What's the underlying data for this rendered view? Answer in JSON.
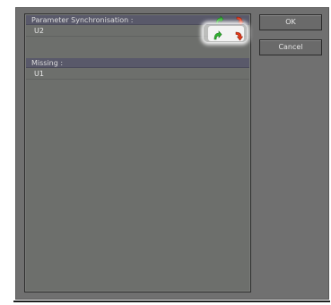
{
  "sync_section": {
    "header": "Parameter Synchronisation :",
    "items": [
      {
        "label": "U2"
      }
    ]
  },
  "missing_section": {
    "header": "Missing :",
    "items": [
      {
        "label": "U1"
      }
    ]
  },
  "buttons": {
    "ok": "OK",
    "cancel": "Cancel"
  },
  "icons": {
    "sync_all": "green-curved-arrow-icon",
    "unsync_all": "red-curved-arrow-icon",
    "sync_item": "green-curved-arrow-icon",
    "unsync_item": "red-curved-arrow-icon"
  },
  "colors": {
    "sync_green": "#2fb32f",
    "unsync_red": "#e23a1a"
  }
}
